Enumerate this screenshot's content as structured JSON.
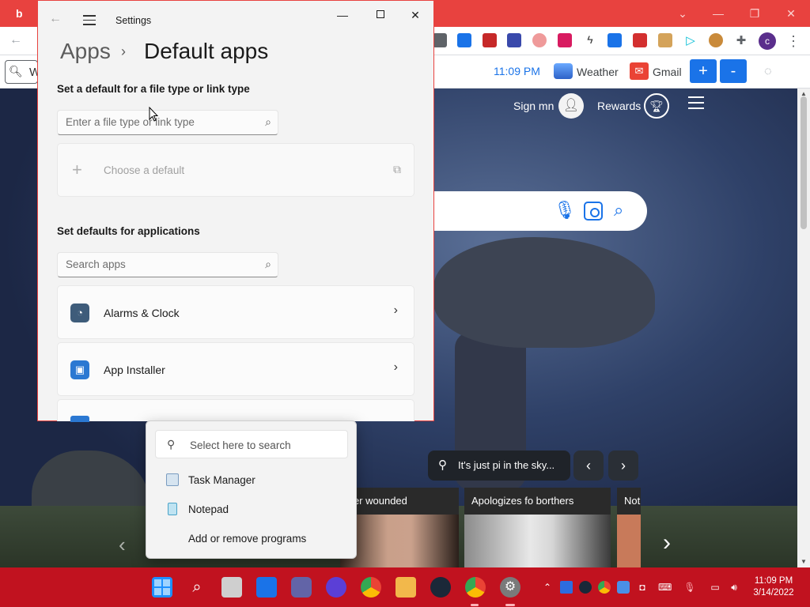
{
  "browser": {
    "bookmarks": {
      "time": "11:09 PM",
      "weather": "Weather",
      "gmail": "Gmail",
      "plus": "+",
      "minus": "-"
    },
    "avatar_letter": "c",
    "address_partial": "W"
  },
  "bing": {
    "sign_in": "Sign mn",
    "rewards": "Rewards",
    "location_pill": "It's just pi in the sky...",
    "news": [
      {
        "caption": "rter wounded"
      },
      {
        "caption": "Apologizes fo borthers"
      },
      {
        "caption": "Not"
      }
    ]
  },
  "settings": {
    "window_title": "Settings",
    "breadcrumb_parent": "Apps",
    "breadcrumb_current": "Default apps",
    "file_type_heading": "Set a default for a file type or link type",
    "file_type_placeholder": "Enter a file type or link type",
    "choose_default": "Choose a default",
    "apps_heading": "Set defaults for applications",
    "search_apps_placeholder": "Search apps",
    "apps": [
      {
        "name": "Alarms & Clock",
        "icon": "clock-icon"
      },
      {
        "name": "App Installer",
        "icon": "package-icon"
      }
    ]
  },
  "context_menu": {
    "search_placeholder": "Select here to search",
    "items": [
      {
        "label": "Task Manager",
        "icon": "task-manager-icon"
      },
      {
        "label": "Notepad",
        "icon": "notepad-icon"
      },
      {
        "label": "Add or remove programs",
        "icon": ""
      }
    ]
  },
  "taskbar": {
    "time": "11:09 PM",
    "date": "3/14/2022",
    "accent": "#c1121f"
  },
  "colors": {
    "browser_frame": "#e8423f",
    "link_blue": "#1a73e8"
  }
}
